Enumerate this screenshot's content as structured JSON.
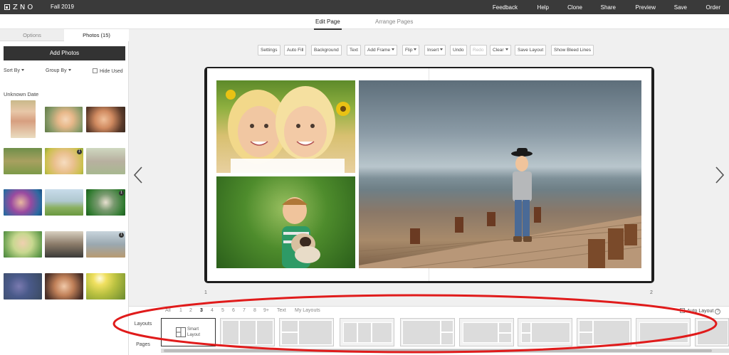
{
  "app": {
    "logo_text": "ZNO",
    "project_name": "Fall 2019",
    "nav": [
      "Feedback",
      "Help",
      "Clone",
      "Share",
      "Preview",
      "Save",
      "Order"
    ]
  },
  "editor_tabs": {
    "edit_page": "Edit Page",
    "arrange_pages": "Arrange Pages",
    "active": "Edit Page"
  },
  "left_panel": {
    "tabs": {
      "options": "Options",
      "photos": "Photos (15)",
      "active": "Photos (15)"
    },
    "add_photos": "Add Photos",
    "sort_by": "Sort By",
    "group_by": "Group By",
    "hide_used": "Hide Used",
    "date_group": "Unknown Date",
    "thumbnails": [
      {
        "desc": "woman with flowers",
        "badge": ""
      },
      {
        "desc": "smiling toddler",
        "badge": ""
      },
      {
        "desc": "laughing child",
        "badge": ""
      },
      {
        "desc": "family on grass",
        "badge": ""
      },
      {
        "desc": "two sisters",
        "badge": "1"
      },
      {
        "desc": "family portrait",
        "badge": ""
      },
      {
        "desc": "girl in purple hat",
        "badge": ""
      },
      {
        "desc": "group in field",
        "badge": ""
      },
      {
        "desc": "boy with dog",
        "badge": "1"
      },
      {
        "desc": "girl with flower crown",
        "badge": ""
      },
      {
        "desc": "family of four",
        "badge": ""
      },
      {
        "desc": "boy on pier",
        "badge": "1"
      },
      {
        "desc": "kids in sunset field",
        "badge": ""
      },
      {
        "desc": "three girls laughing",
        "badge": ""
      },
      {
        "desc": "family walking at sunset",
        "badge": ""
      }
    ]
  },
  "toolbar": {
    "buttons": [
      {
        "label": "Settings",
        "dropdown": false,
        "enabled": true
      },
      {
        "label": "Auto Fill",
        "dropdown": false,
        "enabled": true
      },
      {
        "label": "Background",
        "dropdown": false,
        "enabled": true
      },
      {
        "label": "Text",
        "dropdown": false,
        "enabled": true
      },
      {
        "label": "Add Frame",
        "dropdown": true,
        "enabled": true
      },
      {
        "label": "Flip",
        "dropdown": true,
        "enabled": true
      },
      {
        "label": "Insert",
        "dropdown": true,
        "enabled": true
      },
      {
        "label": "Undo",
        "dropdown": false,
        "enabled": true
      },
      {
        "label": "Redo",
        "dropdown": false,
        "enabled": false
      },
      {
        "label": "Clear",
        "dropdown": true,
        "enabled": true
      },
      {
        "label": "Save Layout",
        "dropdown": false,
        "enabled": true
      },
      {
        "label": "Show Bleed Lines",
        "dropdown": false,
        "enabled": true
      }
    ]
  },
  "spread": {
    "left_page_number": "1",
    "right_page_number": "2",
    "photos": [
      {
        "name": "two-sisters-photo"
      },
      {
        "name": "boy-with-dog-photo"
      },
      {
        "name": "boy-on-pier-photo"
      }
    ]
  },
  "bottom_panel": {
    "side_tabs": {
      "layouts": "Layouts",
      "pages": "Pages",
      "active": "Layouts"
    },
    "photo_count_filters": [
      "All",
      "1",
      "2",
      "3",
      "4",
      "5",
      "6",
      "7",
      "8",
      "9+",
      "Text",
      "My Layouts"
    ],
    "selected_filter": "3",
    "auto_layout": "Auto Layout",
    "smart_layout": "Smart Layout"
  },
  "colors": {
    "topbar": "#3a3a3a",
    "accent": "#333333",
    "annotation_red": "#e01b1b"
  }
}
